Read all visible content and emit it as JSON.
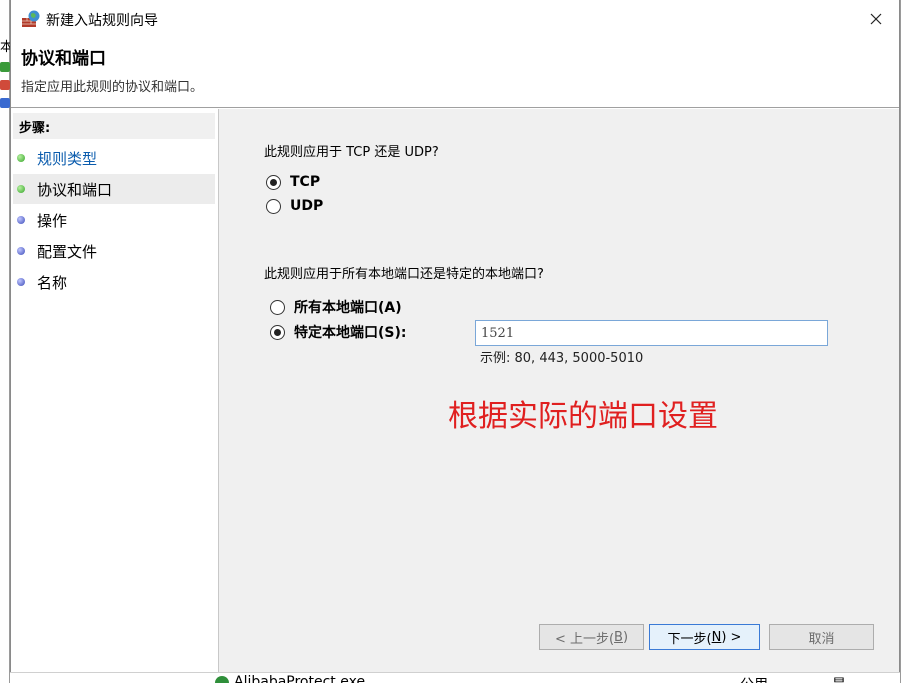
{
  "window": {
    "title": "新建入站规则向导"
  },
  "background": {
    "left_fragment": "本",
    "bottom_row": {
      "name": "AlibabaProtect.exe",
      "col2": "公用",
      "col3": "是"
    }
  },
  "header": {
    "title": "协议和端口",
    "subtitle": "指定应用此规则的协议和端口。"
  },
  "steps": {
    "heading": "步骤:",
    "items": [
      {
        "label": "规则类型",
        "state": "done"
      },
      {
        "label": "协议和端口",
        "state": "current"
      },
      {
        "label": "操作",
        "state": "todo"
      },
      {
        "label": "配置文件",
        "state": "todo"
      },
      {
        "label": "名称",
        "state": "todo"
      }
    ]
  },
  "protocol": {
    "question": "此规则应用于 TCP 还是 UDP?",
    "options": [
      {
        "label": "TCP",
        "selected": true
      },
      {
        "label": "UDP",
        "selected": false
      }
    ]
  },
  "ports": {
    "question": "此规则应用于所有本地端口还是特定的本地端口?",
    "options": [
      {
        "label": "所有本地端口(A)",
        "selected": false
      },
      {
        "label": "特定本地端口(S):",
        "selected": true
      }
    ],
    "value": "1521",
    "example": "示例: 80, 443, 5000-5010"
  },
  "annotation": "根据实际的端口设置",
  "buttons": {
    "back": {
      "text": "< 上一步(",
      "key": "B",
      "end": ")"
    },
    "next": {
      "text": "下一步(",
      "key": "N",
      "end": ") >"
    },
    "cancel": "取消"
  },
  "colors": {
    "link": "#0b5cad",
    "annotation": "#e02020",
    "primary_border": "#3a7ad6"
  },
  "icons": {
    "app": "firewall-globe-icon",
    "close": "close-icon"
  }
}
